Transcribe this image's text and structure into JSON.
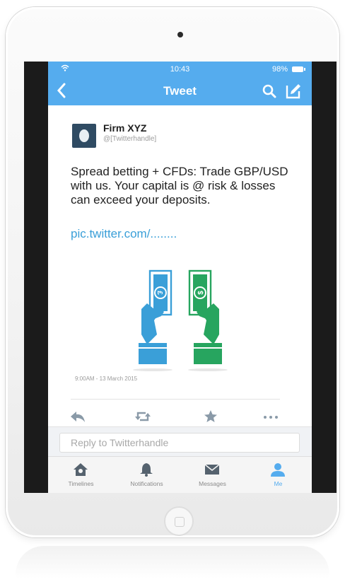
{
  "status_bar": {
    "time": "10:43",
    "battery": "98%"
  },
  "nav": {
    "back_icon": "chevron-left-icon",
    "title": "Tweet",
    "search_icon": "search-icon",
    "compose_icon": "compose-icon"
  },
  "tweet": {
    "name": "Firm XYZ",
    "handle": "@[Twitterhandle]",
    "text": "Spread betting + CFDs: Trade GBP/USD with us. Your capital is @ risk & losses can exceed your deposits.",
    "link": "pic.twitter.com/........",
    "timestamp": "9:00AM - 13 March 2015"
  },
  "actions": [
    "reply-icon",
    "retweet-icon",
    "favorite-icon",
    "more-icon"
  ],
  "reply": {
    "placeholder": "Reply to Twitterhandle"
  },
  "tabs": [
    {
      "label": "Timelines",
      "icon": "home-icon",
      "active": false
    },
    {
      "label": "Notifications",
      "icon": "bell-icon",
      "active": false
    },
    {
      "label": "Messages",
      "icon": "envelope-icon",
      "active": false
    },
    {
      "label": "Me",
      "icon": "person-icon",
      "active": true
    }
  ],
  "colors": {
    "twitter_blue": "#55acee",
    "hand_blue": "#3a9fd8",
    "hand_green": "#27a55f"
  }
}
